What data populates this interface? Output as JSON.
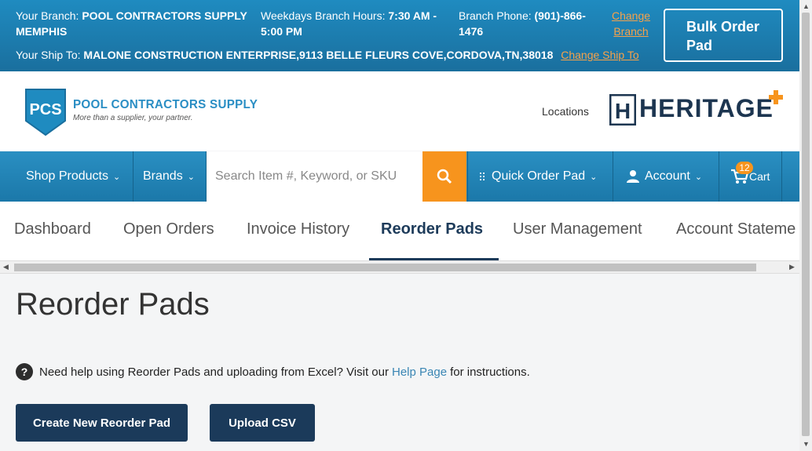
{
  "topbar": {
    "branch_label": "Your Branch:",
    "branch_name_line1": "POOL CONTRACTORS SUPPLY",
    "branch_name_line2": "MEMPHIS",
    "hours_label": "Weekdays Branch Hours:",
    "hours_line1": "7:30 AM -",
    "hours_line2": "5:00 PM",
    "phone_label": "Branch Phone:",
    "phone_line1": "(901)-866-",
    "phone_line2": "1476",
    "change_branch_line1": "Change",
    "change_branch_line2": "Branch",
    "shipto_label": "Your Ship To:",
    "shipto_value": "MALONE CONSTRUCTION ENTERPRISE,9113 BELLE FLEURS COVE,CORDOVA,TN,38018",
    "change_shipto": "Change Ship To",
    "bulk_line1": "Bulk Order",
    "bulk_line2": "Pad"
  },
  "header": {
    "logo_initials": "PCS",
    "logo_name": "POOL CONTRACTORS SUPPLY",
    "logo_tagline": "More than a supplier, your partner.",
    "locations": "Locations",
    "heritage_name": "HERITAGE",
    "heritage_mark": "H"
  },
  "nav": {
    "shop_products": "Shop Products",
    "brands": "Brands",
    "search_placeholder": "Search Item #, Keyword, or SKU",
    "quick_order": "Quick Order Pad",
    "account": "Account",
    "cart_count": "12",
    "cart": "Cart"
  },
  "tabs": [
    {
      "label": "Dashboard"
    },
    {
      "label": "Open Orders"
    },
    {
      "label": "Invoice History"
    },
    {
      "label": "Reorder Pads"
    },
    {
      "label": "User Management"
    },
    {
      "label": "Account Stateme"
    }
  ],
  "content": {
    "title": "Reorder Pads",
    "help_pre": "Need help using Reorder Pads and uploading from Excel? Visit our",
    "help_link": "Help Page",
    "help_post": "for instructions.",
    "help_icon_glyph": "?",
    "create_button": "Create New Reorder Pad",
    "upload_button": "Upload CSV"
  },
  "colors": {
    "brand_blue": "#1f8bc0",
    "navy": "#1b3a5a",
    "accent_orange": "#f7941d"
  }
}
